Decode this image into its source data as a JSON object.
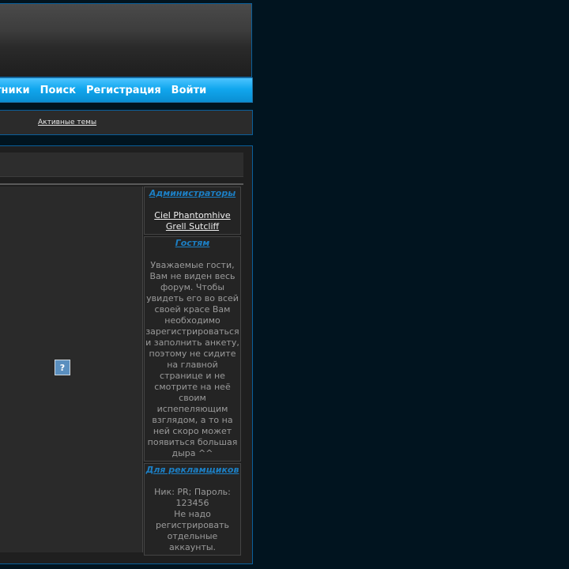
{
  "nav": {
    "items": [
      "тники",
      "Поиск",
      "Регистрация",
      "Войти"
    ]
  },
  "subbar": {
    "active_topics": "Активные темы"
  },
  "sidebar": {
    "admins": {
      "title": "Администраторы",
      "members": [
        "Ciel Phantomhive",
        "Grell Sutcliff"
      ]
    },
    "guests": {
      "title": "Гостям",
      "text": "Уважаемые гости, Вам не виден весь форум. Чтобы увидеть его во всей своей красе Вам необходимо зарегистрироваться и заполнить анкету, поэтому не сидите на главной странице и не смотрите на неё своим испепеляющим взглядом, а то на ней скоро может появиться большая дыра ^^"
    },
    "advertisers": {
      "title": "Для рекламщиков",
      "credentials": "Ник: PR; Пароль: 123456",
      "note": "Не надо регистрировать отдельные аккаунты."
    }
  },
  "content": {
    "image_placeholder": "?"
  },
  "colors": {
    "page_bg": "#01141f",
    "nav_blue": "#11a7ee",
    "accent_link": "#1c7fc4",
    "border_blue": "#0b5f9a"
  }
}
